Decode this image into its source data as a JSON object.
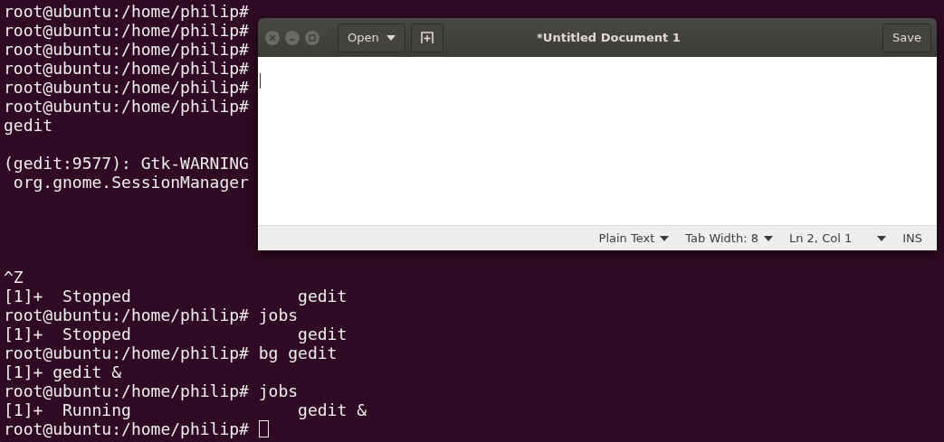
{
  "terminal": {
    "lines": [
      {
        "kind": "text",
        "text": "root@ubuntu:/home/philip#"
      },
      {
        "kind": "text",
        "text": "root@ubuntu:/home/philip#"
      },
      {
        "kind": "text",
        "text": "root@ubuntu:/home/philip#"
      },
      {
        "kind": "text",
        "text": "root@ubuntu:/home/philip#"
      },
      {
        "kind": "text",
        "text": "root@ubuntu:/home/philip#"
      },
      {
        "kind": "text",
        "text": "root@ubuntu:/home/philip#"
      },
      {
        "kind": "text",
        "text": "gedit"
      },
      {
        "kind": "blank"
      },
      {
        "kind": "text",
        "text": "(gedit:9577): Gtk-WARNING"
      },
      {
        "kind": "text",
        "text": " org.gnome.SessionManager"
      },
      {
        "kind": "blank"
      },
      {
        "kind": "blank"
      },
      {
        "kind": "blank"
      },
      {
        "kind": "blank"
      },
      {
        "kind": "text",
        "text": "^Z"
      },
      {
        "kind": "text",
        "text": "[1]+  Stopped                 gedit"
      },
      {
        "kind": "text",
        "text": "root@ubuntu:/home/philip# jobs"
      },
      {
        "kind": "text",
        "text": "[1]+  Stopped                 gedit"
      },
      {
        "kind": "text",
        "text": "root@ubuntu:/home/philip# bg gedit"
      },
      {
        "kind": "text",
        "text": "[1]+ gedit &"
      },
      {
        "kind": "text",
        "text": "root@ubuntu:/home/philip# jobs"
      },
      {
        "kind": "text",
        "text": "[1]+  Running                 gedit &"
      },
      {
        "kind": "text",
        "text": "root@ubuntu:/home/philip#",
        "cursor": true
      }
    ]
  },
  "gedit": {
    "title": "*Untitled Document 1",
    "open_button": "Open",
    "save_button": "Save",
    "status_bar": {
      "language": "Plain Text",
      "tab_width": "Tab Width: 8",
      "position": "Ln 2, Col 1",
      "mode": "INS"
    }
  }
}
